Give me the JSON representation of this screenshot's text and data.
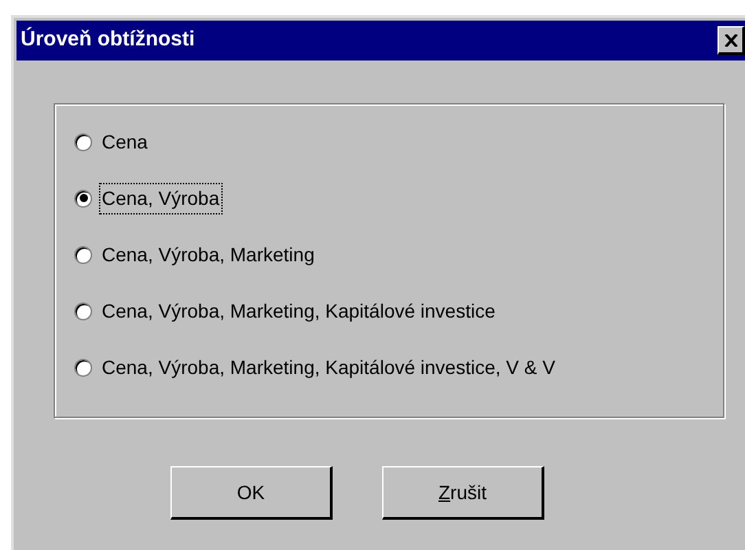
{
  "window": {
    "title": "Úroveň obtížnosti"
  },
  "options": [
    {
      "label": "Cena",
      "selected": false
    },
    {
      "label": "Cena, Výroba",
      "selected": true
    },
    {
      "label": "Cena, Výroba, Marketing",
      "selected": false
    },
    {
      "label": "Cena, Výroba, Marketing, Kapitálové investice",
      "selected": false
    },
    {
      "label": "Cena, Výroba, Marketing, Kapitálové investice, V & V",
      "selected": false
    }
  ],
  "buttons": [
    {
      "label": "OK",
      "access_key_underlined": false
    },
    {
      "label": "Zrušit",
      "access_key_underlined": true
    }
  ]
}
